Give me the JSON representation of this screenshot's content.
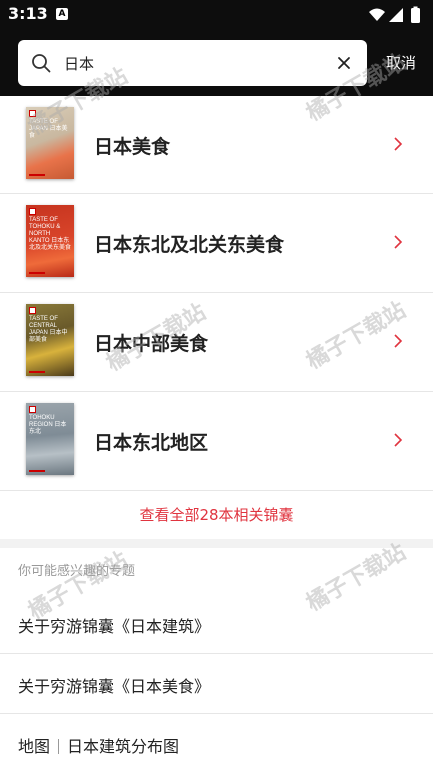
{
  "status_bar": {
    "time": "3:13",
    "notification_badge": "A",
    "icons": [
      "wifi-icon",
      "signal-icon",
      "battery-icon"
    ]
  },
  "search": {
    "query": "日本",
    "cancel_label": "取消"
  },
  "results": {
    "books": [
      {
        "name": "日本美食",
        "cover_title": "TASTE OF JAPAN 日本美食",
        "cover_color": "#c9b8a0",
        "cover_accent": "#e8734a"
      },
      {
        "name": "日本东北及北关东美食",
        "cover_title": "TASTE OF TOHOKU & NORTH KANTO 日本东北及北关东美食",
        "cover_color": "#c6341f",
        "cover_accent": "#ef6b3a"
      },
      {
        "name": "日本中部美食",
        "cover_title": "TASTE OF CENTRAL JAPAN 日本中部美食",
        "cover_color": "#6a5a2a",
        "cover_accent": "#d8b23c"
      },
      {
        "name": "日本东北地区",
        "cover_title": "TOHOKU REGION 日本东北",
        "cover_color": "#7f8c96",
        "cover_accent": "#b7c0c6"
      }
    ],
    "see_all_label": "查看全部28本相关锦囊"
  },
  "topics": {
    "heading": "你可能感兴趣的专题",
    "items": [
      {
        "label": "关于穷游锦囊《日本建筑》"
      },
      {
        "label": "关于穷游锦囊《日本美食》"
      },
      {
        "prefix": "地图",
        "label": "日本建筑分布图"
      }
    ]
  },
  "watermark": "橘子下载站",
  "colors": {
    "accent": "#e0343f",
    "header_bg": "#0d0d0d",
    "chevron": "#e0343f"
  }
}
